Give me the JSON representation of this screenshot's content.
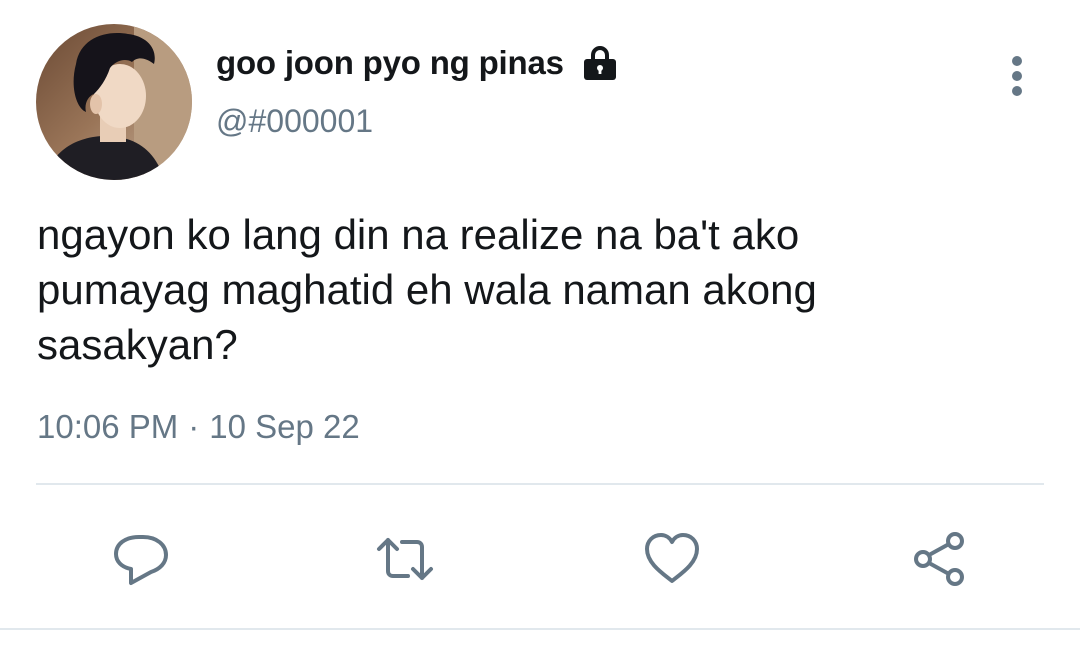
{
  "tweet": {
    "display_name": "goo joon pyo ng pinas",
    "handle": "@#000001",
    "protected_icon": "lock-icon",
    "text": "ngayon ko lang din na realize na ba't ako\npumayag maghatid eh wala naman akong\nsasakyan?",
    "time": "10:06 PM",
    "separator": "·",
    "date": "10 Sep 22"
  },
  "actions": {
    "reply_icon": "speech-bubble-icon",
    "retweet_icon": "retweet-icon",
    "like_icon": "heart-icon",
    "share_icon": "share-icon"
  },
  "colors": {
    "text": "#14171a",
    "muted": "#657786",
    "divider": "#e1e8ed",
    "icon": "#657786"
  }
}
